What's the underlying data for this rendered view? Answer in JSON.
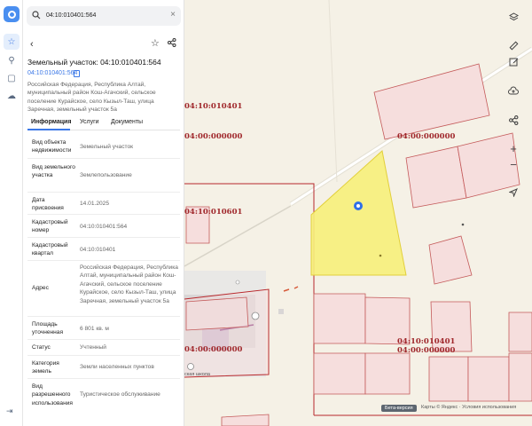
{
  "search": {
    "value": "04:10:010401:564"
  },
  "parcel": {
    "title": "Земельный участок: 04:10:010401:564",
    "cadastral_link": "04:10:010401:564",
    "address": "Российская Федерация, Республика Алтай, муниципальный район Кош-Агачский, сельское поселение Курайское, село Кызыл-Таш, улица Заречная, земельный участок 5а"
  },
  "tabs": [
    {
      "label": "Информация"
    },
    {
      "label": "Услуги"
    },
    {
      "label": "Документы"
    }
  ],
  "info": [
    {
      "key": "Вид объекта недвижимости",
      "value": "Земельный участок"
    },
    {
      "key": "Вид земельного участка",
      "value": "Землепользование"
    },
    {
      "key": "Дата присвоения",
      "value": "14.01.2025"
    },
    {
      "key": "Кадастровый номер",
      "value": "04:10:010401:564"
    },
    {
      "key": "Кадастровый квартал",
      "value": "04:10:010401"
    },
    {
      "key": "Адрес",
      "value": "Российская Федерация, Республика Алтай, муниципальный район Кош-Агачский, сельское поселение Курайское, село Кызыл-Таш, улица Заречная, земельный участок 5а"
    },
    {
      "key": "Площадь уточненная",
      "value": "6 801 кв. м"
    },
    {
      "key": "Статус",
      "value": "Учтенный"
    },
    {
      "key": "Категория земель",
      "value": "Земли населенных пунктов"
    },
    {
      "key": "Вид разрешенного использования",
      "value": "Туристическое обслуживание"
    }
  ],
  "map_labels": {
    "l1": "04:10:010401",
    "l2": "04:00:000000",
    "l3": "04:00:000000",
    "l4": "04:10:010601",
    "l5": "04:10:010401",
    "l6": "04:00:000000",
    "l7": "04:00:000000",
    "place": "ская школа"
  },
  "attribution": {
    "badge": "Бета-версия",
    "text": "Карты © Яндекс · Условия использования"
  },
  "colors": {
    "accent": "#3b78e7",
    "parcel_fill": "#f7ef7a",
    "boundary": "#b8282c",
    "plot_fill": "#f6dedd"
  }
}
